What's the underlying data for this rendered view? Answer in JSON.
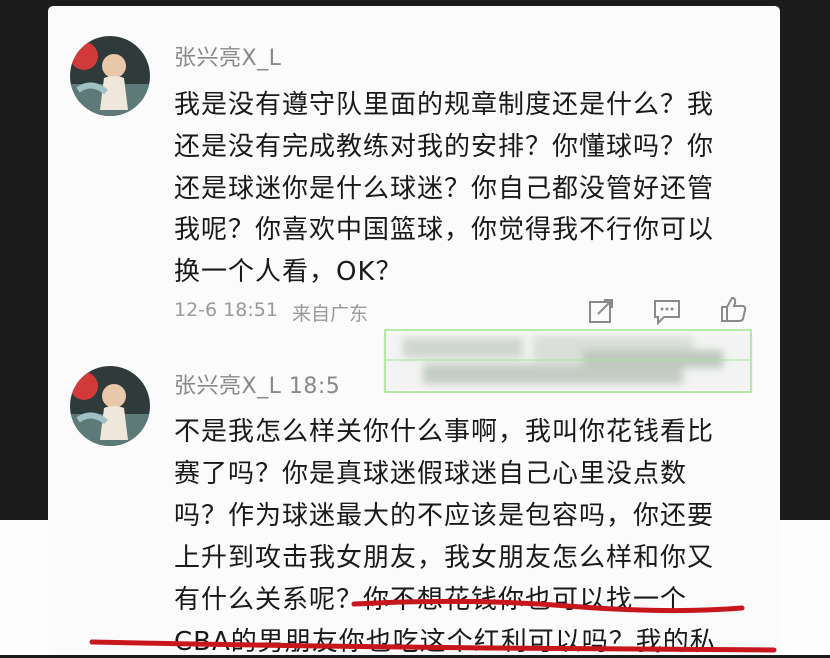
{
  "comments": [
    {
      "username": "张兴亮X_L",
      "lines": [
        "我是没有遵守队里面的规章制度还是什么？我",
        "还是没有完成教练对我的安排？你懂球吗？你",
        "还是球迷你是什么球迷？你自己都没管好还管",
        "我呢？你喜欢中国篮球，你觉得我不行你可以",
        "换一个人看，OK？"
      ],
      "meta_time": "12-6 18:51",
      "meta_location": "来自广东"
    },
    {
      "username": "张兴亮X_L 18:5",
      "lines": [
        "不是我怎么样关你什么事啊，我叫你花钱看比",
        "赛了吗？你是真球迷假球迷自己心里没点数",
        "吗？作为球迷最大的不应该是包容吗，你还要",
        "上升到攻击我女朋友，我女朋友怎么样和你又",
        "有什么关系呢？你不想花钱你也可以找一个",
        "CBA的男朋友你也吃这个红利可以吗？我的私"
      ]
    }
  ],
  "icons": [
    "avatar-image",
    "share-icon",
    "comment-icon",
    "like-icon"
  ],
  "colors": {
    "underline_red": "#c8161d",
    "text": "#1a1a1a",
    "meta": "#9a9a9a"
  }
}
